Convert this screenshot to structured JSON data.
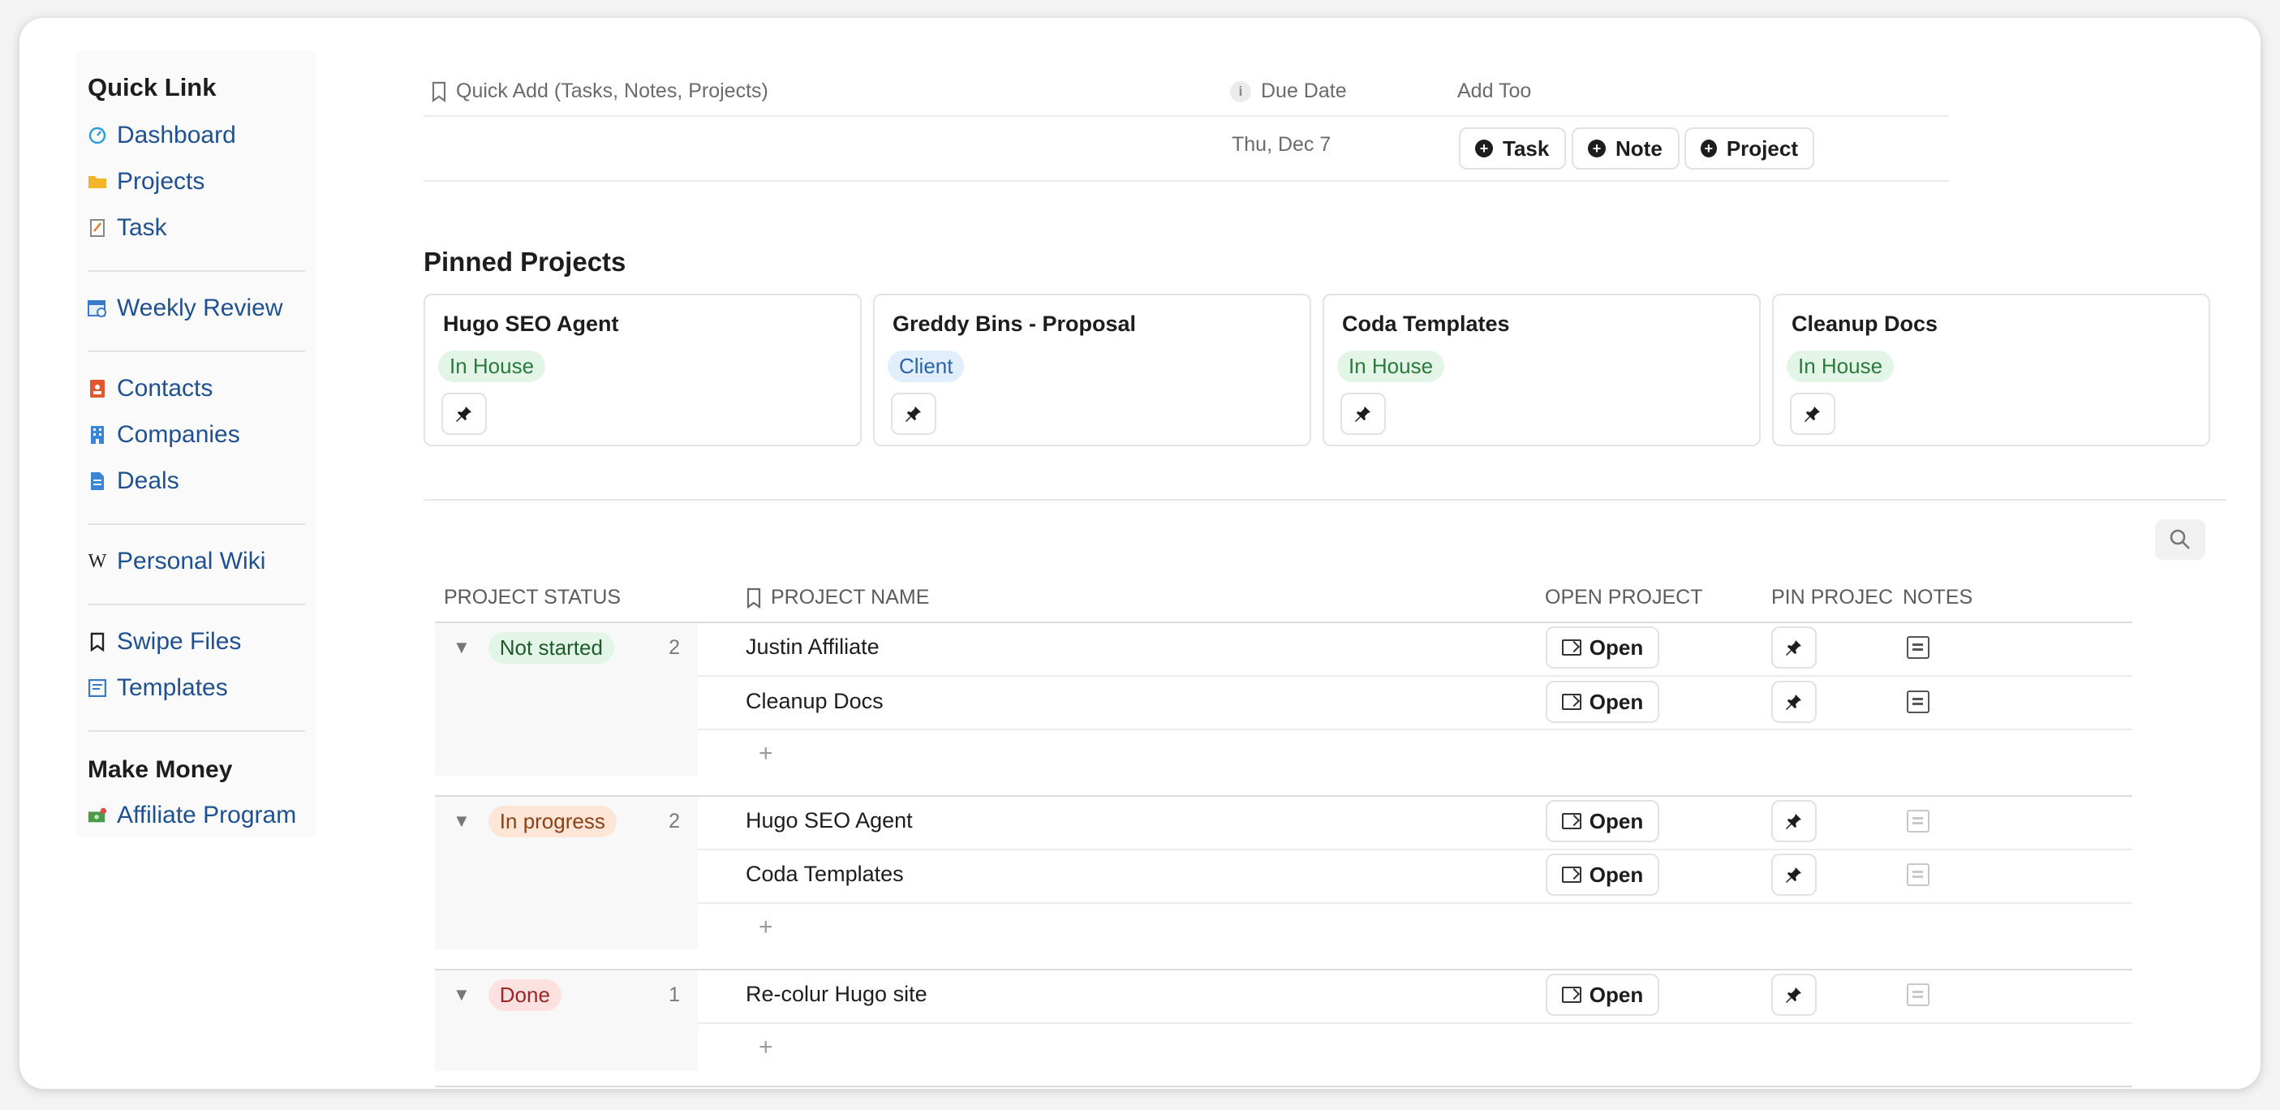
{
  "sidebar": {
    "heading1": "Quick Link",
    "links1": [
      {
        "label": "Dashboard",
        "icon": "gauge-icon"
      },
      {
        "label": "Projects",
        "icon": "folder-icon"
      },
      {
        "label": "Task",
        "icon": "memo-icon"
      }
    ],
    "weekly_review": "Weekly Review",
    "contacts": "Contacts",
    "companies": "Companies",
    "deals": "Deals",
    "personal_wiki": "Personal Wiki",
    "swipe_files": "Swipe Files",
    "templates": "Templates",
    "heading2": "Make Money",
    "affiliate": "Affiliate Program"
  },
  "quick_add": {
    "label": "Quick Add (Tasks, Notes, Projects)",
    "due_label": "Due Date",
    "add_too_label": "Add Too",
    "due_value": "Thu, Dec 7",
    "buttons": [
      "Task",
      "Note",
      "Project"
    ]
  },
  "pinned": {
    "title": "Pinned Projects",
    "cards": [
      {
        "name": "Hugo SEO Agent",
        "tag": "In House"
      },
      {
        "name": "Greddy Bins - Proposal",
        "tag": "Client"
      },
      {
        "name": "Coda Templates",
        "tag": "In House"
      },
      {
        "name": "Cleanup Docs",
        "tag": "In House"
      }
    ]
  },
  "table": {
    "headers": {
      "status": "PROJECT STATUS",
      "name": "PROJECT NAME",
      "open": "OPEN PROJECT",
      "pin": "PIN PROJEC",
      "notes": "NOTES"
    },
    "open_label": "Open",
    "add_symbol": "+",
    "groups": [
      {
        "status": "Not started",
        "count": "2",
        "rows": [
          "Justin Affiliate",
          "Cleanup Docs"
        ]
      },
      {
        "status": "In progress",
        "count": "2",
        "rows": [
          "Hugo SEO Agent",
          "Coda Templates"
        ]
      },
      {
        "status": "Done",
        "count": "1",
        "rows": [
          "Re-colur Hugo site"
        ]
      }
    ]
  },
  "colors": {
    "link": "#1f5191",
    "in_house_tag": "#e3f5e6",
    "client_tag": "#e1eefc",
    "in_progress_tag": "#fde6d6",
    "done_tag": "#fde1e1"
  }
}
